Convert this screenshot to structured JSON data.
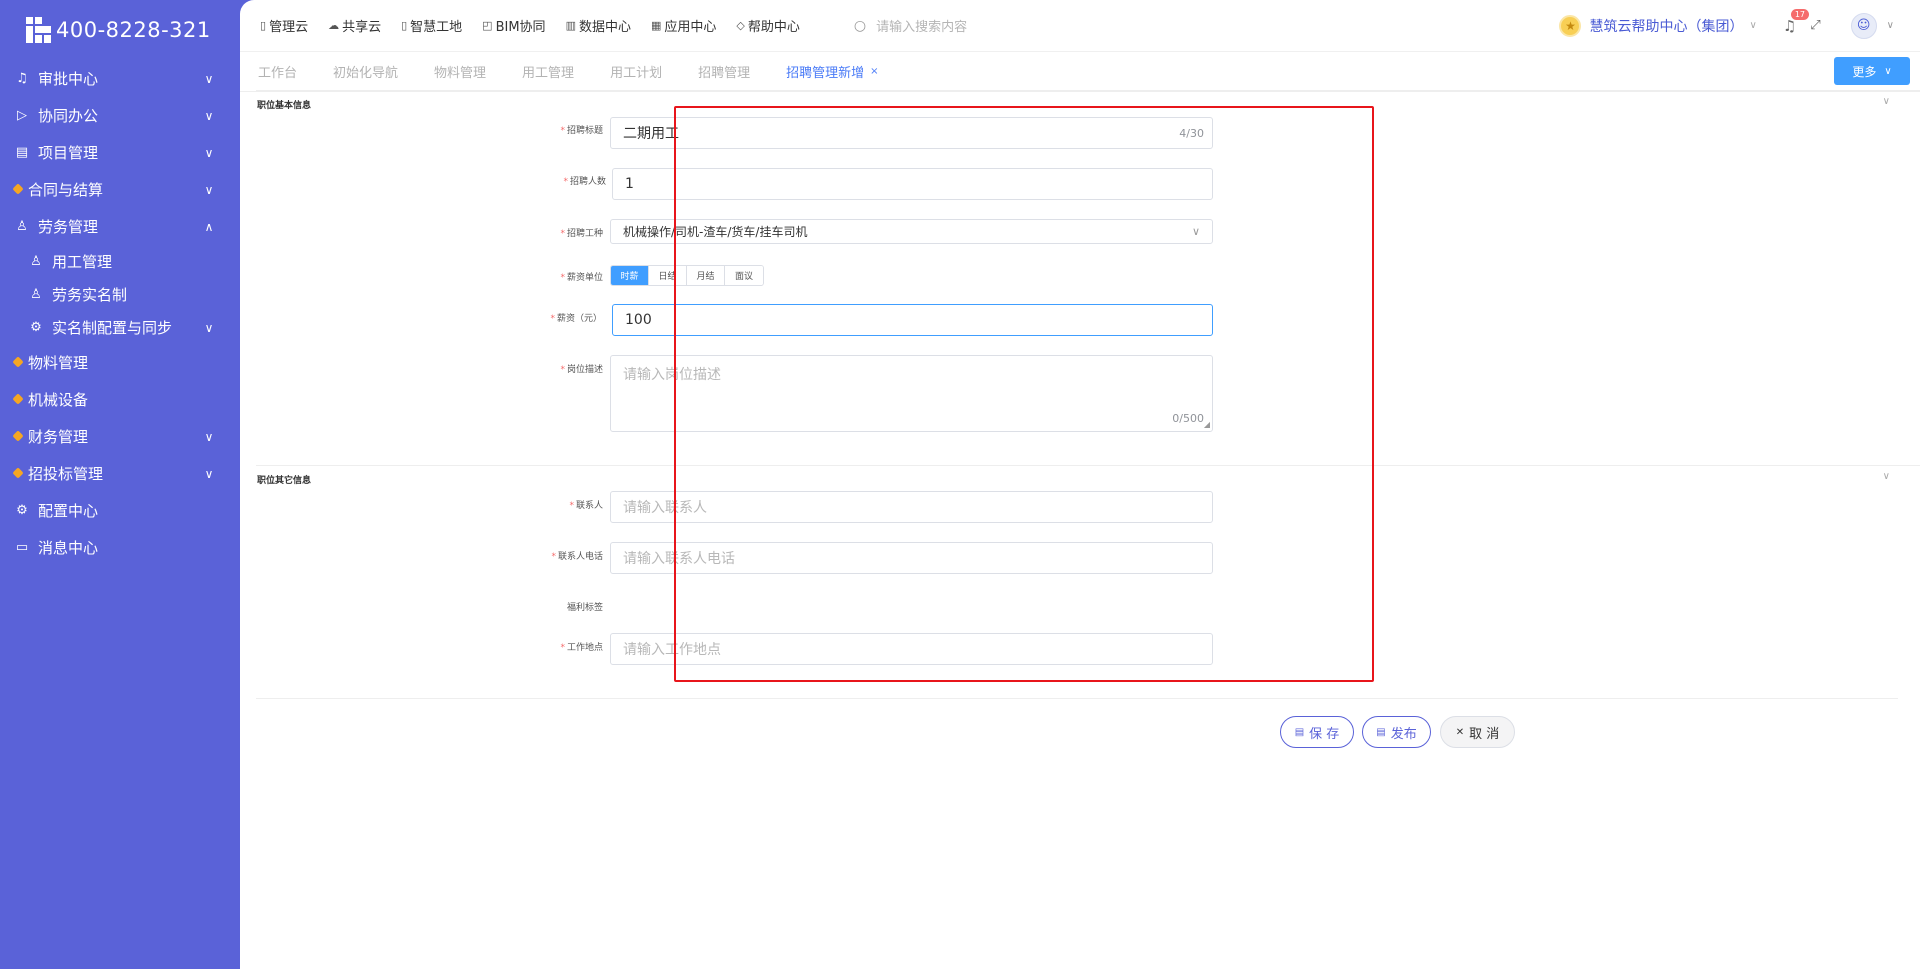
{
  "logo": {
    "phone": "400-8228-321"
  },
  "sidebar": {
    "items": [
      {
        "label": "审批中心",
        "icon": "bell-icon",
        "glyph": "♫",
        "chevron": "∨"
      },
      {
        "label": "协同办公",
        "icon": "send-icon",
        "glyph": "▷",
        "chevron": "∨"
      },
      {
        "label": "项目管理",
        "icon": "book-icon",
        "glyph": "▤",
        "chevron": "∨"
      },
      {
        "label": "合同与结算",
        "icon": "gem-icon",
        "glyph": "",
        "chevron": "∨"
      },
      {
        "label": "劳务管理",
        "icon": "user-icon",
        "glyph": "♙",
        "chevron": "∧"
      },
      {
        "label": "用工管理",
        "icon": "user-icon",
        "glyph": "♙",
        "chevron": ""
      },
      {
        "label": "劳务实名制",
        "icon": "user-icon",
        "glyph": "♙",
        "chevron": ""
      },
      {
        "label": "实名制配置与同步",
        "icon": "gear-icon",
        "glyph": "⚙",
        "chevron": "∨"
      },
      {
        "label": "物料管理",
        "icon": "gem-icon",
        "glyph": "",
        "chevron": ""
      },
      {
        "label": "机械设备",
        "icon": "gem-icon",
        "glyph": "",
        "chevron": ""
      },
      {
        "label": "财务管理",
        "icon": "gem-icon",
        "glyph": "",
        "chevron": "∨"
      },
      {
        "label": "招投标管理",
        "icon": "gem-icon",
        "glyph": "",
        "chevron": "∨"
      },
      {
        "label": "配置中心",
        "icon": "gear-icon",
        "glyph": "⚙",
        "chevron": ""
      },
      {
        "label": "消息中心",
        "icon": "message-icon",
        "glyph": "▭",
        "chevron": ""
      }
    ]
  },
  "topnav": {
    "items": [
      {
        "label": "管理云",
        "glyph": "▯"
      },
      {
        "label": "共享云",
        "glyph": "☁"
      },
      {
        "label": "智慧工地",
        "glyph": "▯"
      },
      {
        "label": "BIM协同",
        "glyph": "◰"
      },
      {
        "label": "数据中心",
        "glyph": "▥"
      },
      {
        "label": "应用中心",
        "glyph": "▦"
      },
      {
        "label": "帮助中心",
        "glyph": "◇"
      }
    ],
    "search_placeholder": "请输入搜索内容",
    "help_center": "慧筑云帮助中心（集团）",
    "notification_count": "17"
  },
  "tabs": [
    {
      "label": "工作台",
      "active": false
    },
    {
      "label": "初始化导航",
      "active": false
    },
    {
      "label": "物料管理",
      "active": false
    },
    {
      "label": "用工管理",
      "active": false
    },
    {
      "label": "用工计划",
      "active": false
    },
    {
      "label": "招聘管理",
      "active": false
    },
    {
      "label": "招聘管理新增",
      "active": true
    }
  ],
  "more_label": "更多",
  "sections": {
    "basic": "职位基本信息",
    "other": "职位其它信息"
  },
  "form": {
    "title": {
      "label": "招聘标题",
      "value": "二期用工",
      "counter": "4/30"
    },
    "headcount": {
      "label": "招聘人数",
      "value": "1"
    },
    "worktype": {
      "label": "招聘工种",
      "value": "机械操作/司机-渣车/货车/挂车司机"
    },
    "salary_unit": {
      "label": "薪资单位",
      "options": [
        "时薪",
        "日结",
        "月结",
        "面议"
      ],
      "selected": "时薪"
    },
    "salary": {
      "label": "薪资（元）",
      "value": "100"
    },
    "description": {
      "label": "岗位描述",
      "placeholder": "请输入岗位描述",
      "counter": "0/500"
    },
    "contact": {
      "label": "联系人",
      "placeholder": "请输入联系人"
    },
    "phone": {
      "label": "联系人电话",
      "placeholder": "请输入联系人电话"
    },
    "benefits": {
      "label": "福利标签"
    },
    "location": {
      "label": "工作地点",
      "placeholder": "请输入工作地点"
    }
  },
  "buttons": {
    "save": "保 存",
    "publish": "发布",
    "cancel": "取 消"
  },
  "colors": {
    "sidebar": "#5a62d8",
    "primary": "#409eff",
    "highlight": "#e8151b"
  }
}
